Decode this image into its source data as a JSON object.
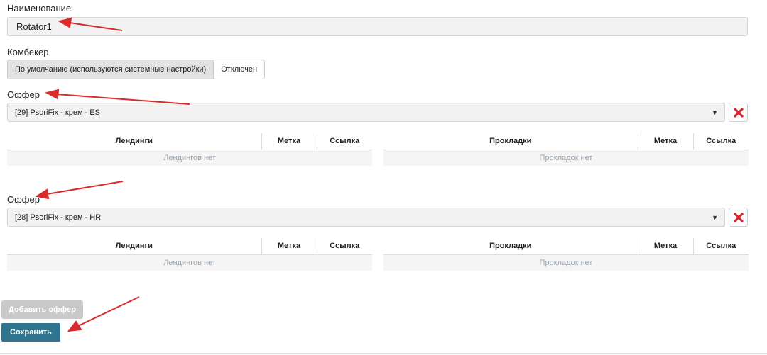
{
  "form": {
    "name_label": "Наименование",
    "name_value": "Rotator1",
    "combacker_label": "Комбекер",
    "combacker_options": [
      "По умолчанию (используются системные настройки)",
      "Отключен"
    ],
    "combacker_selected": "По умолчанию (используются системные настройки)"
  },
  "offers": [
    {
      "label": "Оффер",
      "selected": "[29] PsoriFix - крем - ES",
      "landings": {
        "columns": [
          "Лендинги",
          "Метка",
          "Ссылка"
        ],
        "empty": "Лендингов нет"
      },
      "prelandings": {
        "columns": [
          "Прокладки",
          "Метка",
          "Ссылка"
        ],
        "empty": "Прокладок нет"
      }
    },
    {
      "label": "Оффер",
      "selected": "[28] PsoriFix - крем - HR",
      "landings": {
        "columns": [
          "Лендинги",
          "Метка",
          "Ссылка"
        ],
        "empty": "Лендингов нет"
      },
      "prelandings": {
        "columns": [
          "Прокладки",
          "Метка",
          "Ссылка"
        ],
        "empty": "Прокладок нет"
      }
    }
  ],
  "actions": {
    "add_offer": "Добавить оффер",
    "save": "Сохранить"
  },
  "icons": {
    "caret": "caret-down-icon",
    "delete": "close-icon"
  },
  "colors": {
    "save_button": "#2f7590",
    "add_button_disabled": "#c9c9c9",
    "delete_icon": "#d9242b",
    "annotation_arrow": "#d92b2b"
  }
}
